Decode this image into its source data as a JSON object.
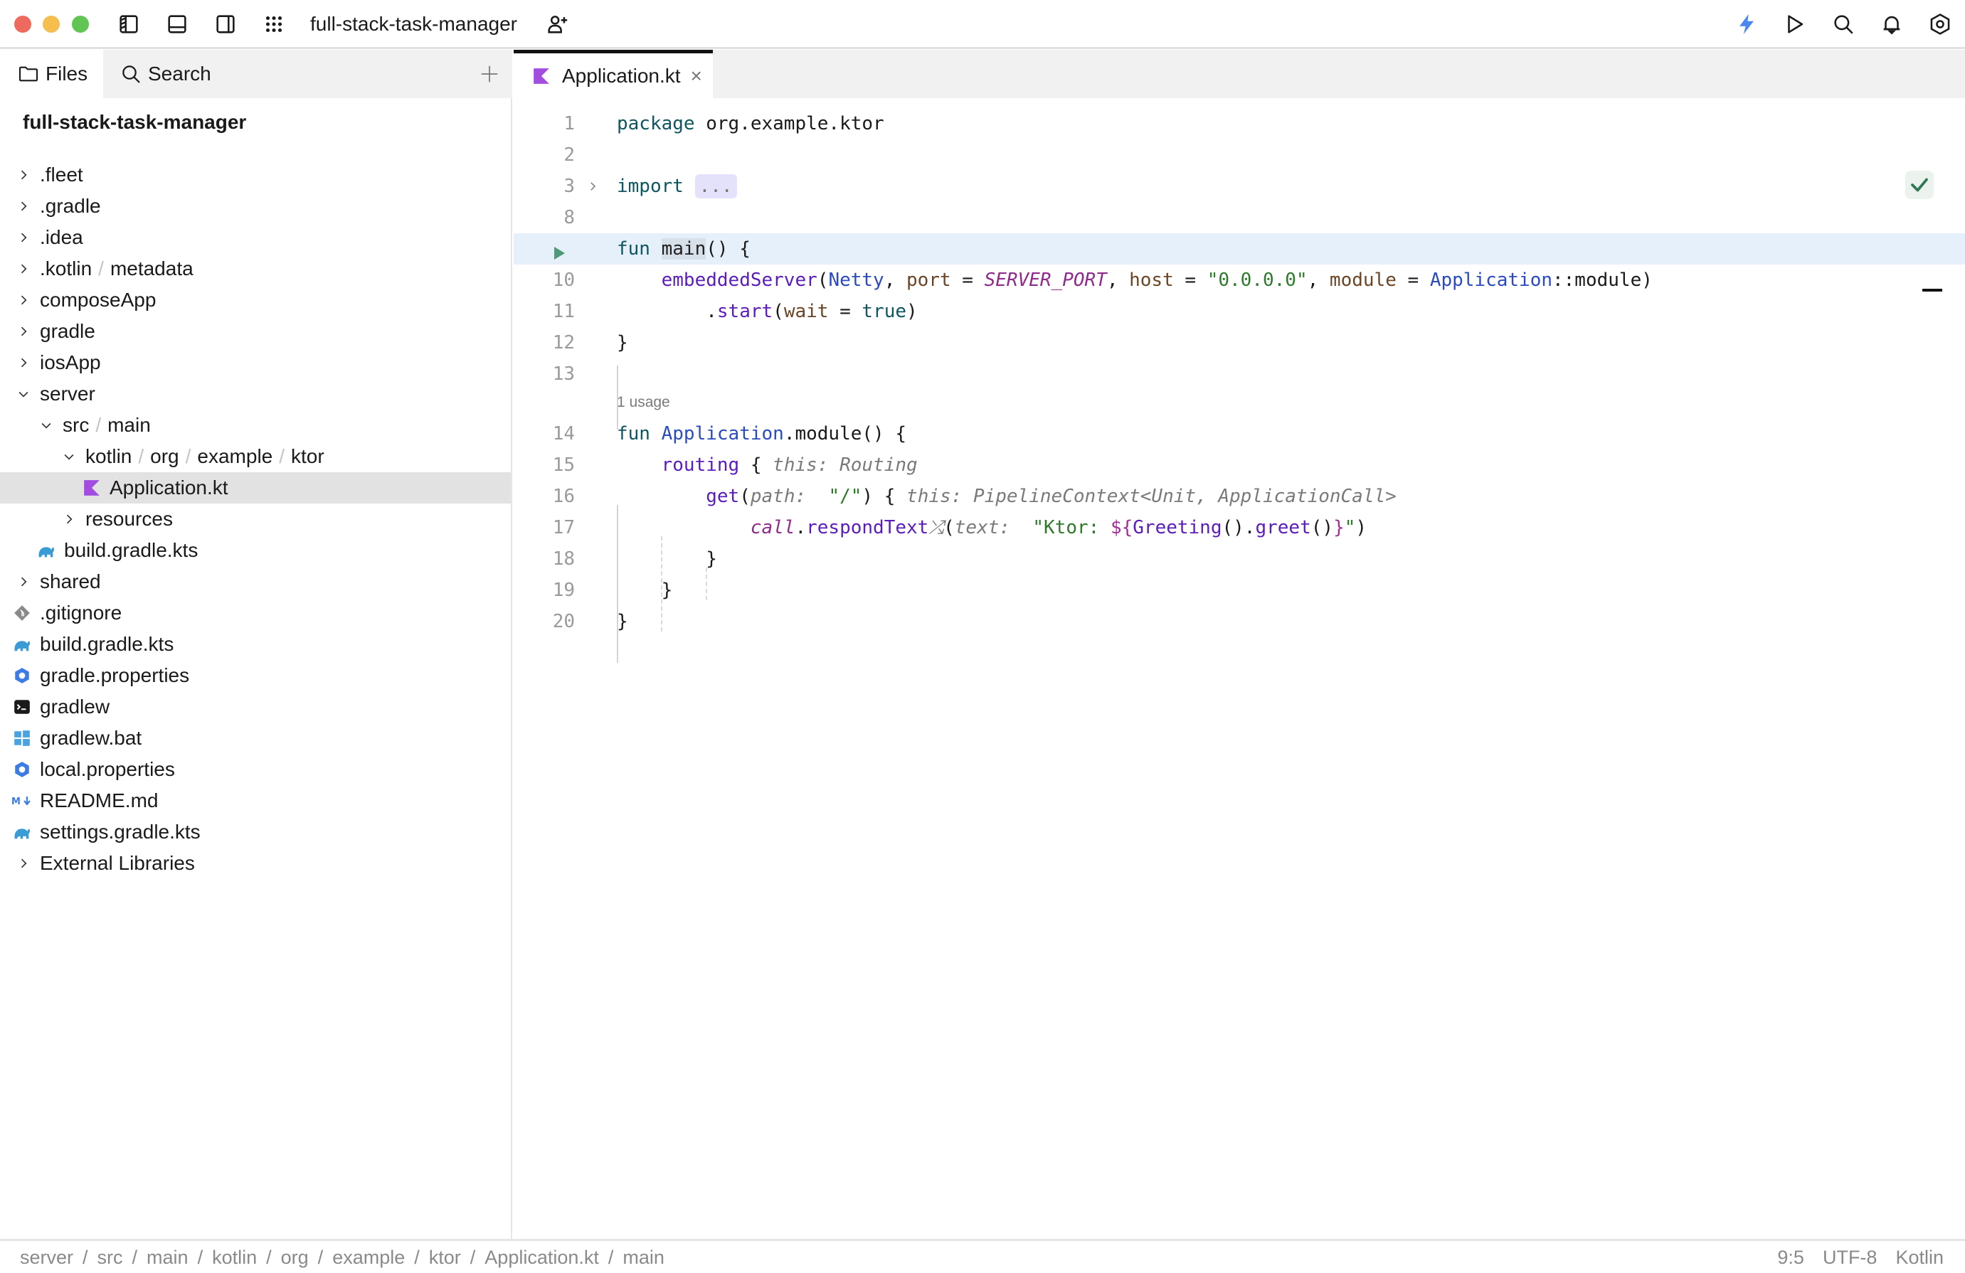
{
  "window": {
    "project_name": "full-stack-task-manager",
    "traffic_lights": {
      "close": "#ee6a5f",
      "minimize": "#f5be4f",
      "maximize": "#61c554"
    }
  },
  "toolbar": {
    "left_icons": [
      "toggle-left-panel-icon",
      "toggle-bottom-panel-icon",
      "toggle-right-panel-icon",
      "app-grid-icon"
    ],
    "share_icon": "add-user-icon",
    "right_icons": [
      "lightning-icon",
      "run-icon",
      "search-icon",
      "bell-icon",
      "settings-icon"
    ],
    "accent_color": "#4a86f0"
  },
  "left_panel": {
    "tabs": [
      {
        "label": "Files",
        "icon": "folder-icon",
        "active": true
      },
      {
        "label": "Search",
        "icon": "search-icon",
        "active": false
      }
    ],
    "add_icon": "plus-icon",
    "tree": {
      "root": "full-stack-task-manager",
      "items": [
        {
          "label": ".fleet",
          "depth": 0,
          "type": "folder",
          "state": "collapsed"
        },
        {
          "label": ".gradle",
          "depth": 0,
          "type": "folder",
          "state": "collapsed"
        },
        {
          "label": ".idea",
          "depth": 0,
          "type": "folder",
          "state": "collapsed"
        },
        {
          "label": ".kotlin",
          "label2": "metadata",
          "depth": 0,
          "type": "folder",
          "state": "collapsed"
        },
        {
          "label": "composeApp",
          "depth": 0,
          "type": "folder",
          "state": "collapsed"
        },
        {
          "label": "gradle",
          "depth": 0,
          "type": "folder",
          "state": "collapsed"
        },
        {
          "label": "iosApp",
          "depth": 0,
          "type": "folder",
          "state": "collapsed"
        },
        {
          "label": "server",
          "depth": 0,
          "type": "folder",
          "state": "expanded"
        },
        {
          "label": "src",
          "label2": "main",
          "depth": 1,
          "type": "folder",
          "state": "expanded"
        },
        {
          "label": "kotlin",
          "label2": "org",
          "label3": "example",
          "label4": "ktor",
          "depth": 2,
          "type": "folder",
          "state": "expanded"
        },
        {
          "label": "Application.kt",
          "depth": 3,
          "type": "kotlin-file",
          "selected": true
        },
        {
          "label": "resources",
          "depth": 2,
          "type": "folder",
          "state": "collapsed"
        },
        {
          "label": "build.gradle.kts",
          "depth": 1,
          "type": "gradle-file"
        },
        {
          "label": "shared",
          "depth": 0,
          "type": "folder",
          "state": "collapsed"
        },
        {
          "label": ".gitignore",
          "depth": 0,
          "type": "git-file"
        },
        {
          "label": "build.gradle.kts",
          "depth": 0,
          "type": "gradle-file"
        },
        {
          "label": "gradle.properties",
          "depth": 0,
          "type": "properties-file"
        },
        {
          "label": "gradlew",
          "depth": 0,
          "type": "terminal-file"
        },
        {
          "label": "gradlew.bat",
          "depth": 0,
          "type": "windows-file"
        },
        {
          "label": "local.properties",
          "depth": 0,
          "type": "properties-file"
        },
        {
          "label": "README.md",
          "depth": 0,
          "type": "markdown-file"
        },
        {
          "label": "settings.gradle.kts",
          "depth": 0,
          "type": "gradle-file"
        },
        {
          "label": "External Libraries",
          "depth": 0,
          "type": "folder",
          "state": "collapsed"
        }
      ]
    }
  },
  "editor": {
    "tabs": [
      {
        "label": "Application.kt",
        "icon": "kotlin-icon",
        "active": true,
        "close_label": "×"
      }
    ],
    "inspection_status": "check-icon",
    "lines": [
      {
        "n": "1",
        "tokens": [
          [
            "kw",
            "package"
          ],
          [
            "plain",
            " org.example.ktor"
          ]
        ]
      },
      {
        "n": "2",
        "tokens": []
      },
      {
        "n": "3",
        "fold": true,
        "tokens": [
          [
            "kw",
            "import"
          ],
          [
            "plain",
            " "
          ],
          [
            "collapsed",
            "..."
          ]
        ]
      },
      {
        "n": "8",
        "tokens": []
      },
      {
        "n": "",
        "run": true,
        "current": true,
        "tokens": [
          [
            "kw",
            "fun"
          ],
          [
            "plain",
            " "
          ],
          [
            "main-hl",
            "main"
          ],
          [
            "plain",
            "() {"
          ]
        ]
      },
      {
        "n": "10",
        "tokens": [
          [
            "plain",
            "    "
          ],
          [
            "fn-call",
            "embeddedServer"
          ],
          [
            "plain",
            "("
          ],
          [
            "type",
            "Netty"
          ],
          [
            "plain",
            ", "
          ],
          [
            "param",
            "port"
          ],
          [
            "plain",
            " = "
          ],
          [
            "const",
            "SERVER_PORT"
          ],
          [
            "plain",
            ", "
          ],
          [
            "param",
            "host"
          ],
          [
            "plain",
            " = "
          ],
          [
            "str",
            "\"0.0.0.0\""
          ],
          [
            "plain",
            ", "
          ],
          [
            "param",
            "module"
          ],
          [
            "plain",
            " = "
          ],
          [
            "type",
            "Application"
          ],
          [
            "plain",
            "::module)"
          ]
        ]
      },
      {
        "n": "11",
        "tokens": [
          [
            "plain",
            "        ."
          ],
          [
            "fn-call",
            "start"
          ],
          [
            "plain",
            "("
          ],
          [
            "param",
            "wait"
          ],
          [
            "plain",
            " = "
          ],
          [
            "kw",
            "true"
          ],
          [
            "plain",
            ")"
          ]
        ]
      },
      {
        "n": "12",
        "tokens": [
          [
            "plain",
            "}"
          ]
        ]
      },
      {
        "n": "13",
        "tokens": []
      },
      {
        "n": "14",
        "usage": "1 usage",
        "tokens": [
          [
            "kw",
            "fun"
          ],
          [
            "plain",
            " "
          ],
          [
            "type",
            "Application"
          ],
          [
            "plain",
            ".module() {"
          ]
        ]
      },
      {
        "n": "15",
        "tokens": [
          [
            "plain",
            "    "
          ],
          [
            "fn-call",
            "routing"
          ],
          [
            "plain",
            " { "
          ],
          [
            "hint",
            "this: Routing"
          ]
        ]
      },
      {
        "n": "16",
        "tokens": [
          [
            "plain",
            "        "
          ],
          [
            "fn-call",
            "get"
          ],
          [
            "plain",
            "("
          ],
          [
            "hint",
            "path:"
          ],
          [
            "plain",
            "  "
          ],
          [
            "str",
            "\"/\""
          ],
          [
            "plain",
            ") { "
          ],
          [
            "hint",
            "this: PipelineContext<Unit, ApplicationCall>"
          ]
        ]
      },
      {
        "n": "17",
        "tokens": [
          [
            "plain",
            "            "
          ],
          [
            "const",
            "call"
          ],
          [
            "plain",
            "."
          ],
          [
            "fn-call",
            "respondText"
          ],
          [
            "hint",
            "⤮"
          ],
          [
            "plain",
            "("
          ],
          [
            "hint",
            "text:"
          ],
          [
            "plain",
            "  "
          ],
          [
            "str",
            "\"Ktor: "
          ],
          [
            "dollar",
            "${"
          ],
          [
            "fn-call",
            "Greeting"
          ],
          [
            "plain",
            "()."
          ],
          [
            "fn-call",
            "greet"
          ],
          [
            "plain",
            "()"
          ],
          [
            "dollar",
            "}"
          ],
          [
            "str",
            "\""
          ],
          [
            "plain",
            ")"
          ]
        ]
      },
      {
        "n": "18",
        "tokens": [
          [
            "plain",
            "        }"
          ]
        ]
      },
      {
        "n": "19",
        "tokens": [
          [
            "plain",
            "    }"
          ]
        ]
      },
      {
        "n": "20",
        "tokens": [
          [
            "plain",
            "}"
          ]
        ]
      }
    ]
  },
  "status_bar": {
    "breadcrumbs": [
      "server",
      "src",
      "main",
      "kotlin",
      "org",
      "example",
      "ktor",
      "Application.kt",
      "main"
    ],
    "cursor": "9:5",
    "encoding": "UTF-8",
    "language": "Kotlin"
  }
}
